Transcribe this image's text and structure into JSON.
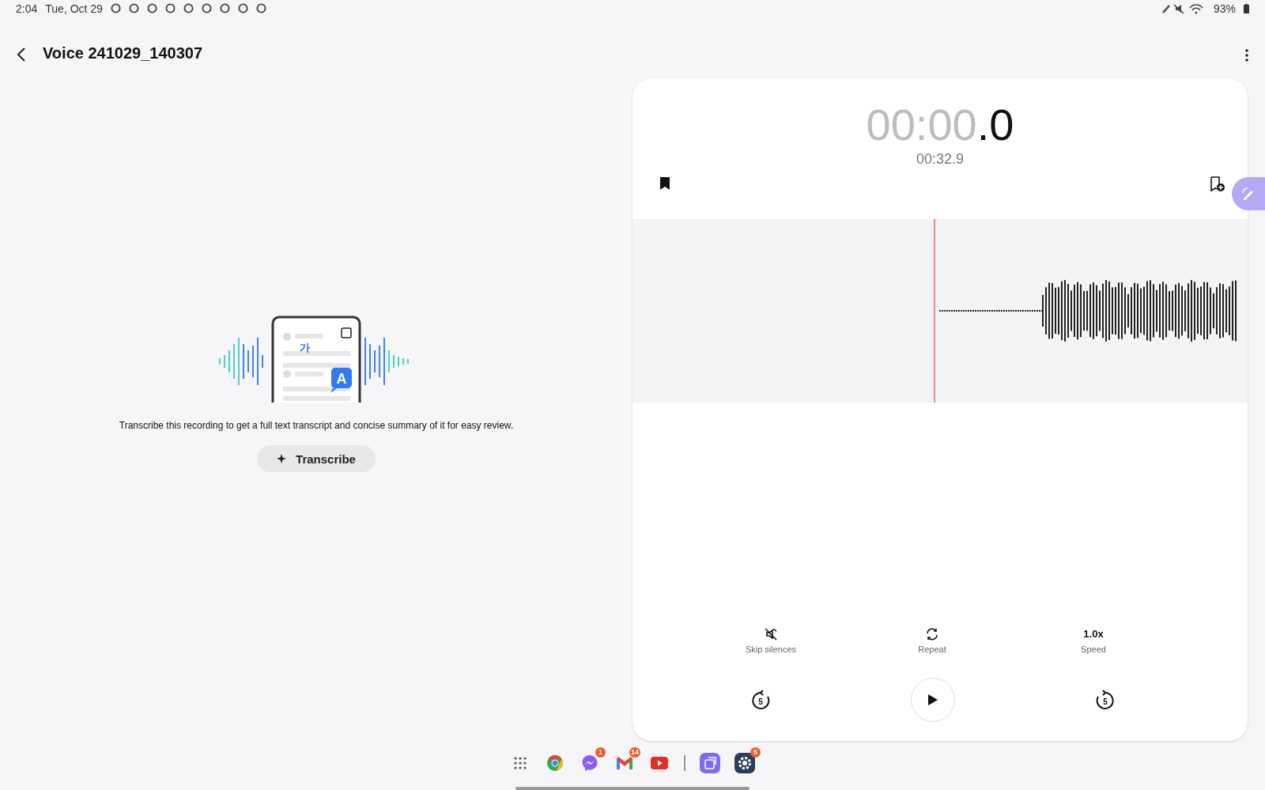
{
  "status_bar": {
    "time": "2:04",
    "date": "Tue, Oct 29",
    "battery": "93%"
  },
  "header": {
    "title": "Voice 241029_140307"
  },
  "transcribe": {
    "illustration_texts": [
      "가",
      "A"
    ],
    "description": "Transcribe this recording to get a full text transcript and concise summary of it for easy review.",
    "button": "Transcribe"
  },
  "player": {
    "elapsed_main": "00:00",
    "elapsed_fraction": ".0",
    "duration": "00:32.9",
    "options": [
      {
        "kind": "skip",
        "label": "Skip silences"
      },
      {
        "kind": "repeat",
        "label": "Repeat"
      },
      {
        "kind": "speed",
        "value": "1.0x",
        "label": "Speed"
      }
    ],
    "rewind": "5",
    "forward": "5"
  },
  "taskbar": {
    "apps": [
      {
        "kind": "grid"
      },
      {
        "kind": "chrome"
      },
      {
        "kind": "messenger",
        "badge": "1"
      },
      {
        "kind": "mail",
        "badge": "14"
      },
      {
        "kind": "video"
      },
      {
        "kind": "divider"
      },
      {
        "kind": "translate"
      },
      {
        "kind": "settings",
        "badge": "5"
      }
    ]
  }
}
